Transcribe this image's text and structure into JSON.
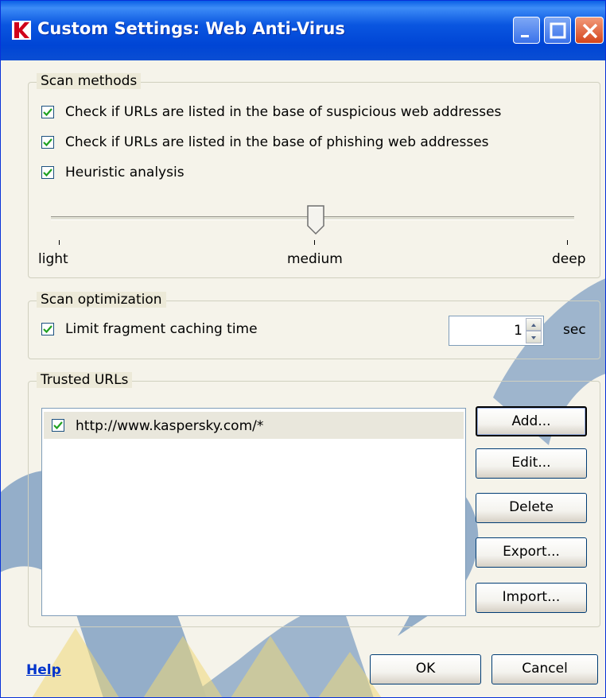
{
  "window": {
    "title": "Custom Settings: Web Anti-Virus",
    "accent": "#0a56e0"
  },
  "scan_methods": {
    "label": "Scan methods",
    "options": [
      {
        "label": "Check if URLs are listed in the base of suspicious web addresses",
        "checked": true
      },
      {
        "label": "Check if URLs are listed in the base of phishing web addresses",
        "checked": true
      },
      {
        "label": "Heuristic analysis",
        "checked": true
      }
    ],
    "slider": {
      "labels": [
        "light",
        "medium",
        "deep"
      ],
      "selected": "medium"
    }
  },
  "scan_optimization": {
    "label": "Scan optimization",
    "option": {
      "label": "Limit fragment caching time",
      "checked": true
    },
    "value": "1",
    "unit": "sec"
  },
  "trusted_urls": {
    "label": "Trusted URLs",
    "items": [
      {
        "url": "http://www.kaspersky.com/*",
        "checked": true
      }
    ],
    "buttons": {
      "add": "Add...",
      "edit": "Edit...",
      "delete": "Delete",
      "export": "Export...",
      "import": "Import..."
    }
  },
  "footer": {
    "help": "Help",
    "ok": "OK",
    "cancel": "Cancel"
  }
}
